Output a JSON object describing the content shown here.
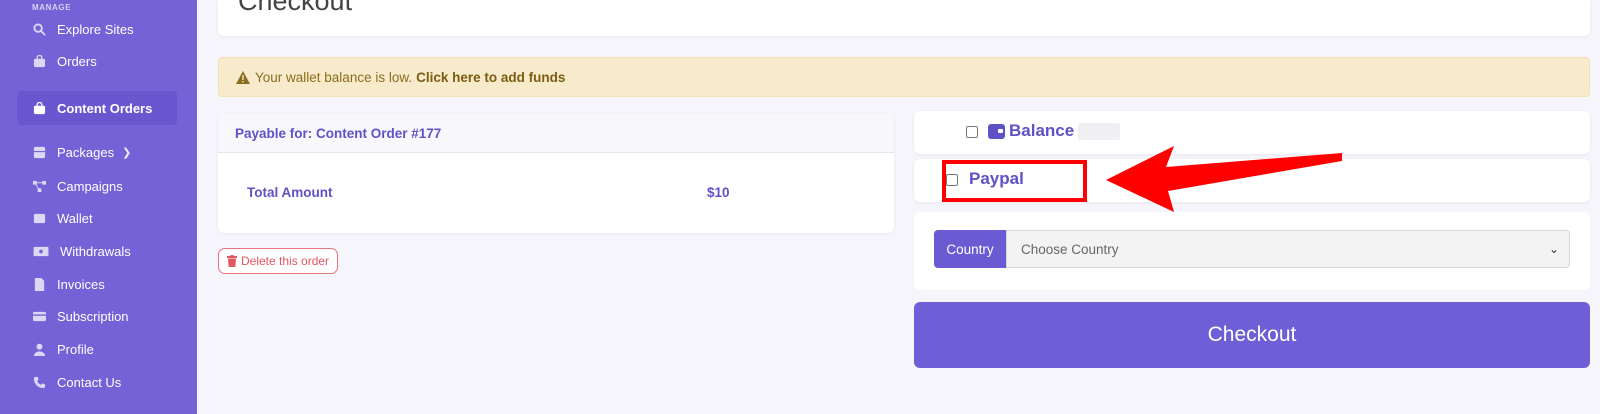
{
  "sidebar": {
    "section_label": "MANAGE",
    "items": [
      {
        "label": "Explore Sites",
        "icon": "search-icon"
      },
      {
        "label": "Orders",
        "icon": "bag-icon"
      },
      {
        "label": "Content Orders",
        "icon": "bag-icon"
      },
      {
        "label": "Packages",
        "icon": "package-icon"
      },
      {
        "label": "Campaigns",
        "icon": "network-icon"
      },
      {
        "label": "Wallet",
        "icon": "wallet-icon"
      },
      {
        "label": "Withdrawals",
        "icon": "money-icon"
      },
      {
        "label": "Invoices",
        "icon": "document-icon"
      },
      {
        "label": "Subscription",
        "icon": "card-icon"
      },
      {
        "label": "Profile",
        "icon": "user-icon"
      },
      {
        "label": "Contact Us",
        "icon": "phone-icon"
      }
    ],
    "active_item": "Content Orders"
  },
  "page": {
    "title": "Checkout"
  },
  "alert": {
    "text": "Your wallet balance is low.",
    "link": "Click here to add funds"
  },
  "order": {
    "header": "Payable for: Content Order #177",
    "total_label": "Total Amount",
    "total_value": "$10",
    "delete_label": "Delete this order"
  },
  "payment": {
    "balance_label": "Balance",
    "paypal_label": "Paypal"
  },
  "country": {
    "label": "Country",
    "placeholder": "Choose Country"
  },
  "checkout_label": "Checkout",
  "colors": {
    "sidebar_bg": "#7462d6",
    "accent": "#5f52c6",
    "button": "#6f5fd6",
    "alert_bg": "#f8ebcc",
    "danger": "#e25563",
    "annotation": "#ff0000"
  }
}
